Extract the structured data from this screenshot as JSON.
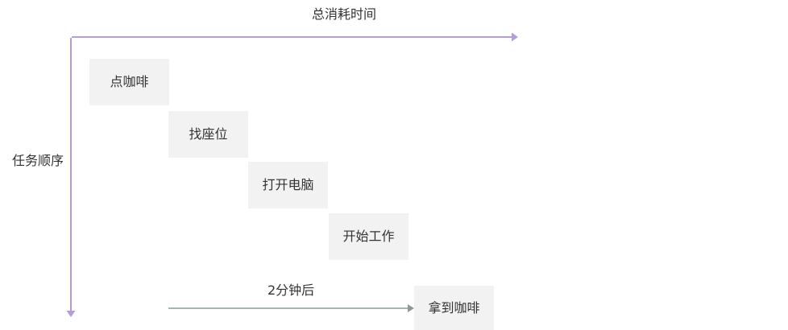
{
  "labels": {
    "total_time": "总消耗时间",
    "task_order": "任务顺序",
    "delay": "2分钟后"
  },
  "tasks": [
    "点咖啡",
    "找座位",
    "打开电脑",
    "开始工作",
    "拿到咖啡"
  ],
  "colors": {
    "axis_arrow": "#b39ddb",
    "delay_arrow": "#8e9a9a",
    "task_fill": "#f2f2f2",
    "text": "#333333"
  }
}
